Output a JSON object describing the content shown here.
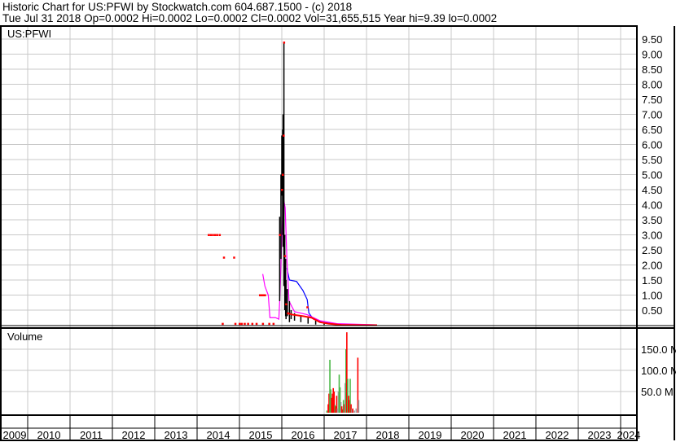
{
  "header": {
    "title": "Historic Chart for US:PFWI by Stockwatch.com 604.687.1500 - (c) 2018",
    "quote": "Tue Jul 31 2018  Op=0.0002  Hi=0.0002  Lo=0.0002  Cl=0.0002  Vol=31,655,515  Year hi=9.39  lo=0.0002"
  },
  "chart_data": {
    "type": "line",
    "symbol": "US:PFWI",
    "volume_label": "Volume",
    "x_ticks": [
      "2009",
      "2010",
      "2011",
      "2012",
      "2013",
      "2014",
      "2015",
      "2016",
      "2017",
      "2018",
      "2019",
      "2020",
      "2021",
      "2022",
      "2023",
      "2024"
    ],
    "price_ticks": [
      "0.50",
      "1.00",
      "1.50",
      "2.00",
      "2.50",
      "3.00",
      "3.50",
      "4.00",
      "4.50",
      "5.00",
      "5.50",
      "6.00",
      "6.50",
      "7.00",
      "7.50",
      "8.00",
      "8.50",
      "9.00",
      "9.50"
    ],
    "volume_ticks": [
      "50.0 M",
      "100.0 M",
      "150.0 M"
    ],
    "price_ylim": [
      0,
      9.75
    ],
    "volume_ylim": [
      0,
      190
    ],
    "colors": {
      "bars": "#000000",
      "close": "#ff0000",
      "ma_short": "#ff00ff",
      "ma_long": "#0000ff",
      "vol_up": "#4cb848",
      "vol_down": "#ff0000",
      "vol_flat": "#a0a0a0",
      "grid": "#c8c8c8"
    },
    "hl_bars": [
      [
        2015.95,
        0.8,
        3.6
      ],
      [
        2015.98,
        2.2,
        5.0
      ],
      [
        2016.0,
        4.3,
        6.3
      ],
      [
        2016.02,
        3.0,
        6.5
      ],
      [
        2016.03,
        2.6,
        7.0
      ],
      [
        2016.05,
        1.3,
        9.39
      ],
      [
        2016.07,
        0.5,
        3.0
      ],
      [
        2016.09,
        0.3,
        2.2
      ],
      [
        2016.1,
        0.2,
        1.5
      ],
      [
        2016.13,
        0.3,
        1.2
      ],
      [
        2016.18,
        0.1,
        0.8
      ],
      [
        2016.22,
        0.2,
        0.5
      ],
      [
        2016.3,
        0.15,
        0.4
      ],
      [
        2016.45,
        0.1,
        0.3
      ],
      [
        2016.62,
        0.05,
        0.25
      ],
      [
        2016.8,
        0.02,
        0.15
      ],
      [
        2017.0,
        0.01,
        0.06
      ]
    ],
    "close_dots": [
      [
        2014.27,
        3.0
      ],
      [
        2014.32,
        3.0
      ],
      [
        2014.37,
        3.0
      ],
      [
        2014.42,
        3.0
      ],
      [
        2014.47,
        3.0
      ],
      [
        2014.53,
        3.0
      ],
      [
        2014.63,
        2.25
      ],
      [
        2014.87,
        2.25
      ],
      [
        2014.6,
        0.05
      ],
      [
        2014.9,
        0.05
      ],
      [
        2015.0,
        0.05
      ],
      [
        2015.05,
        0.05
      ],
      [
        2015.12,
        0.05
      ],
      [
        2015.2,
        0.05
      ],
      [
        2015.3,
        0.05
      ],
      [
        2015.4,
        0.05
      ],
      [
        2015.55,
        0.05
      ],
      [
        2015.7,
        0.05
      ],
      [
        2015.8,
        0.05
      ],
      [
        2015.48,
        1.0
      ],
      [
        2015.52,
        1.0
      ],
      [
        2015.56,
        1.0
      ],
      [
        2015.6,
        1.0
      ],
      [
        2015.95,
        3.0
      ],
      [
        2016.0,
        4.5
      ],
      [
        2016.02,
        5.0
      ],
      [
        2016.04,
        6.3
      ],
      [
        2016.05,
        9.39
      ],
      [
        2016.07,
        2.3
      ],
      [
        2016.1,
        0.7
      ],
      [
        2016.15,
        0.4
      ],
      [
        2016.6,
        0.6
      ]
    ],
    "close_line": [
      [
        2016.12,
        0.4
      ],
      [
        2016.25,
        0.35
      ],
      [
        2016.5,
        0.3
      ],
      [
        2016.7,
        0.25
      ],
      [
        2016.9,
        0.1
      ],
      [
        2017.1,
        0.05
      ],
      [
        2017.4,
        0.01
      ],
      [
        2018.0,
        0.0002
      ],
      [
        2018.25,
        0.0002
      ]
    ],
    "ma_short": [
      [
        2015.55,
        1.7
      ],
      [
        2015.6,
        1.3
      ],
      [
        2015.68,
        1.0
      ],
      [
        2015.72,
        0.25
      ],
      [
        2015.85,
        0.25
      ],
      [
        2015.93,
        0.2
      ],
      [
        2015.96,
        1.1
      ],
      [
        2016.0,
        3.0
      ],
      [
        2016.04,
        4.2
      ],
      [
        2016.08,
        3.9
      ],
      [
        2016.12,
        2.2
      ],
      [
        2016.17,
        0.8
      ],
      [
        2016.3,
        0.45
      ],
      [
        2016.6,
        0.35
      ],
      [
        2016.9,
        0.15
      ],
      [
        2017.3,
        0.05
      ],
      [
        2018.25,
        0.01
      ]
    ],
    "ma_long": [
      [
        2016.12,
        1.9
      ],
      [
        2016.18,
        1.5
      ],
      [
        2016.35,
        1.45
      ],
      [
        2016.5,
        1.15
      ],
      [
        2016.6,
        0.85
      ],
      [
        2016.64,
        0.4
      ],
      [
        2016.75,
        0.2
      ],
      [
        2016.95,
        0.1
      ],
      [
        2017.2,
        0.05
      ],
      [
        2017.5,
        0.02
      ],
      [
        2018.25,
        0.01
      ]
    ],
    "volume_bars": [
      [
        2017.05,
        5,
        "u"
      ],
      [
        2017.08,
        20,
        "d"
      ],
      [
        2017.1,
        45,
        "d"
      ],
      [
        2017.12,
        125,
        "u"
      ],
      [
        2017.14,
        55,
        "u"
      ],
      [
        2017.16,
        35,
        "d"
      ],
      [
        2017.18,
        45,
        "d"
      ],
      [
        2017.2,
        58,
        "d"
      ],
      [
        2017.22,
        50,
        "d"
      ],
      [
        2017.24,
        18,
        "u"
      ],
      [
        2017.26,
        15,
        "d"
      ],
      [
        2017.28,
        40,
        "d"
      ],
      [
        2017.3,
        10,
        "f"
      ],
      [
        2017.32,
        50,
        "f"
      ],
      [
        2017.34,
        90,
        "u"
      ],
      [
        2017.36,
        60,
        "u"
      ],
      [
        2017.38,
        25,
        "f"
      ],
      [
        2017.4,
        15,
        "d"
      ],
      [
        2017.42,
        8,
        "d"
      ],
      [
        2017.44,
        30,
        "u"
      ],
      [
        2017.46,
        20,
        "d"
      ],
      [
        2017.48,
        70,
        "f"
      ],
      [
        2017.5,
        150,
        "u"
      ],
      [
        2017.52,
        190,
        "d"
      ],
      [
        2017.54,
        80,
        "u"
      ],
      [
        2017.56,
        40,
        "d"
      ],
      [
        2017.58,
        30,
        "d"
      ],
      [
        2017.6,
        80,
        "u"
      ],
      [
        2017.62,
        20,
        "d"
      ],
      [
        2017.64,
        8,
        "f"
      ],
      [
        2017.66,
        10,
        "d"
      ],
      [
        2017.7,
        5,
        "f"
      ],
      [
        2017.74,
        10,
        "f"
      ],
      [
        2017.78,
        130,
        "d"
      ],
      [
        2017.8,
        30,
        "f"
      ]
    ]
  }
}
